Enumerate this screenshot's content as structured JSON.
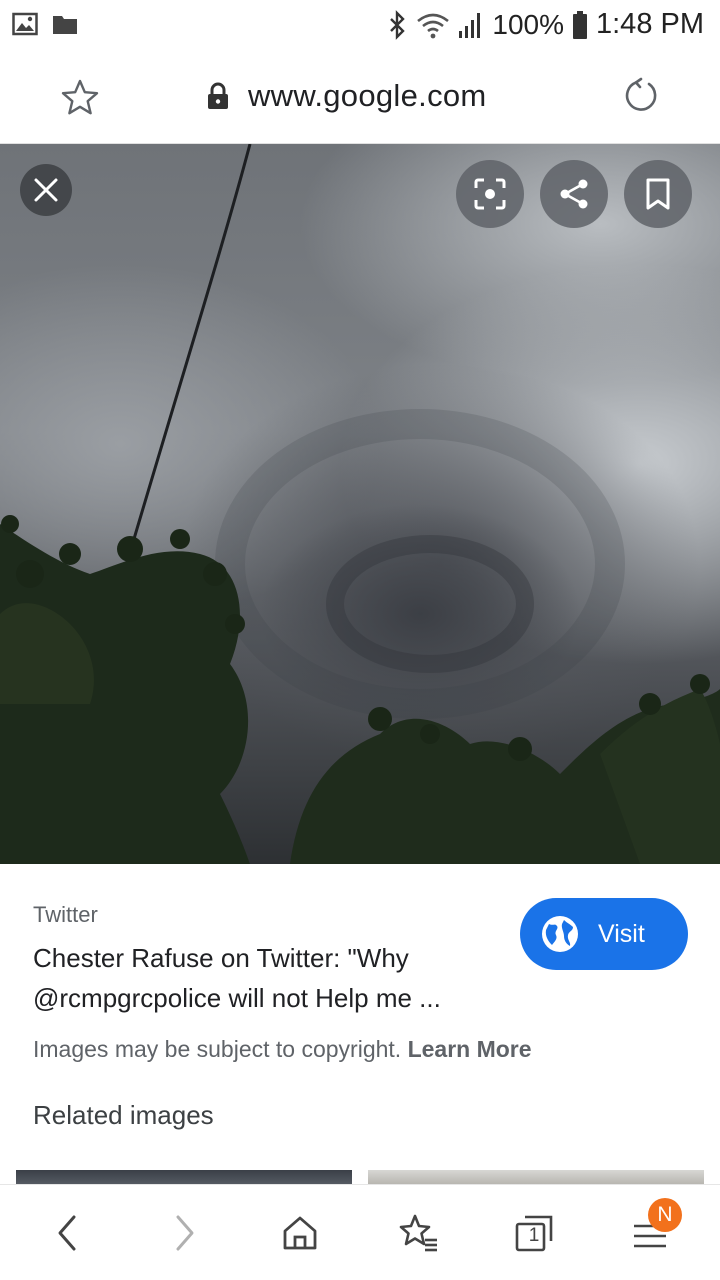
{
  "status_bar": {
    "left_icons": [
      "gallery-icon",
      "folder-icon"
    ],
    "right_icons": [
      "bluetooth-icon",
      "wifi-icon",
      "signal-icon",
      "battery-icon"
    ],
    "battery_percent": "100%",
    "time": "1:48 PM"
  },
  "url_bar": {
    "url": "www.google.com",
    "icons": [
      "star-icon",
      "lock-icon",
      "reload-icon"
    ]
  },
  "viewer": {
    "buttons": [
      "close-icon",
      "lens-icon",
      "share-icon",
      "bookmark-icon"
    ]
  },
  "result": {
    "source": "Twitter",
    "title": "Chester Rafuse on Twitter: \"Why @rcmpgrcpolice will not Help me ...",
    "visit_label": "Visit",
    "copyright_text": "Images may be subject to copyright.",
    "learn_more_label": "Learn More",
    "related_heading": "Related images"
  },
  "bottom_nav": {
    "icons": [
      "back-icon",
      "forward-icon",
      "home-icon",
      "bookmarks-icon",
      "tabs-icon",
      "menu-icon"
    ],
    "tab_count": "1",
    "badge": "N"
  },
  "colors": {
    "accent": "#1a73e8",
    "badge": "#f2711c"
  }
}
